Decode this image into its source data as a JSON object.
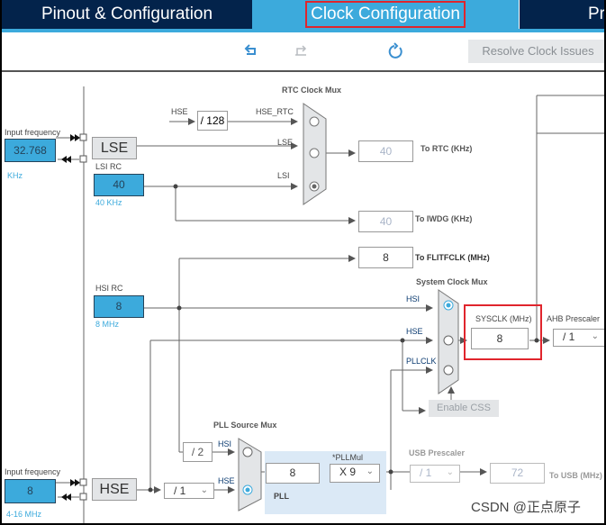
{
  "tabs": [
    {
      "label": "Pinout & Configuration",
      "active": false
    },
    {
      "label": "Clock Configuration",
      "active": true
    },
    {
      "label": "Pr",
      "active": false
    }
  ],
  "toolbar": {
    "undo_icon": "undo-icon",
    "redo_icon": "redo-icon",
    "reset_icon": "refresh-icon",
    "resolve_label": "Resolve Clock Issues"
  },
  "colors": {
    "tab_dark": "#03234b",
    "tab_active": "#3caadc",
    "highlight_red": "#e0252d",
    "input_blue": "#3caadc",
    "pll_region": "#dbe9f6"
  },
  "lse": {
    "input_label": "Input frequency",
    "value": "32.768",
    "unit": "KHz",
    "block": "LSE"
  },
  "lsi": {
    "label": "LSI RC",
    "value": "40",
    "unit": "40 KHz"
  },
  "rtc_mux": {
    "title": "RTC Clock Mux",
    "hse_in": "HSE",
    "divider": "/ 128",
    "inputs": [
      "HSE_RTC",
      "LSE",
      "LSI"
    ],
    "selected": "LSI"
  },
  "outputs": {
    "rtc": {
      "value": "40",
      "label": "To RTC (KHz)"
    },
    "iwdg": {
      "value": "40",
      "label": "To IWDG (KHz)"
    },
    "flitfclk": {
      "value": "8",
      "label": "To FLITFCLK (MHz)"
    },
    "usb": {
      "value": "72",
      "label": "To USB (MHz)"
    }
  },
  "hsi": {
    "label": "HSI RC",
    "value": "8",
    "unit": "8 MHz"
  },
  "sys_mux": {
    "title": "System Clock Mux",
    "inputs": [
      "HSI",
      "HSE",
      "PLLCLK"
    ],
    "selected": "HSI"
  },
  "sysclk": {
    "label": "SYSCLK (MHz)",
    "value": "8"
  },
  "ahb": {
    "label": "AHB Prescaler",
    "value": "/ 1"
  },
  "enable_css": "Enable CSS",
  "hse": {
    "input_label": "Input frequency",
    "value": "8",
    "unit": "4-16 MHz",
    "block": "HSE",
    "prediv": "/ 1"
  },
  "pll_src_mux": {
    "title": "PLL Source Mux",
    "hsi_div": "/ 2",
    "inputs": [
      "HSI",
      "HSE"
    ],
    "selected": "HSE"
  },
  "pll": {
    "value": "8",
    "mul_label": "*PLLMul",
    "mul_value": "X 9",
    "label": "PLL"
  },
  "usb_prescaler": {
    "label": "USB Prescaler",
    "value": "/ 1"
  },
  "watermark": "CSDN @正点原子"
}
